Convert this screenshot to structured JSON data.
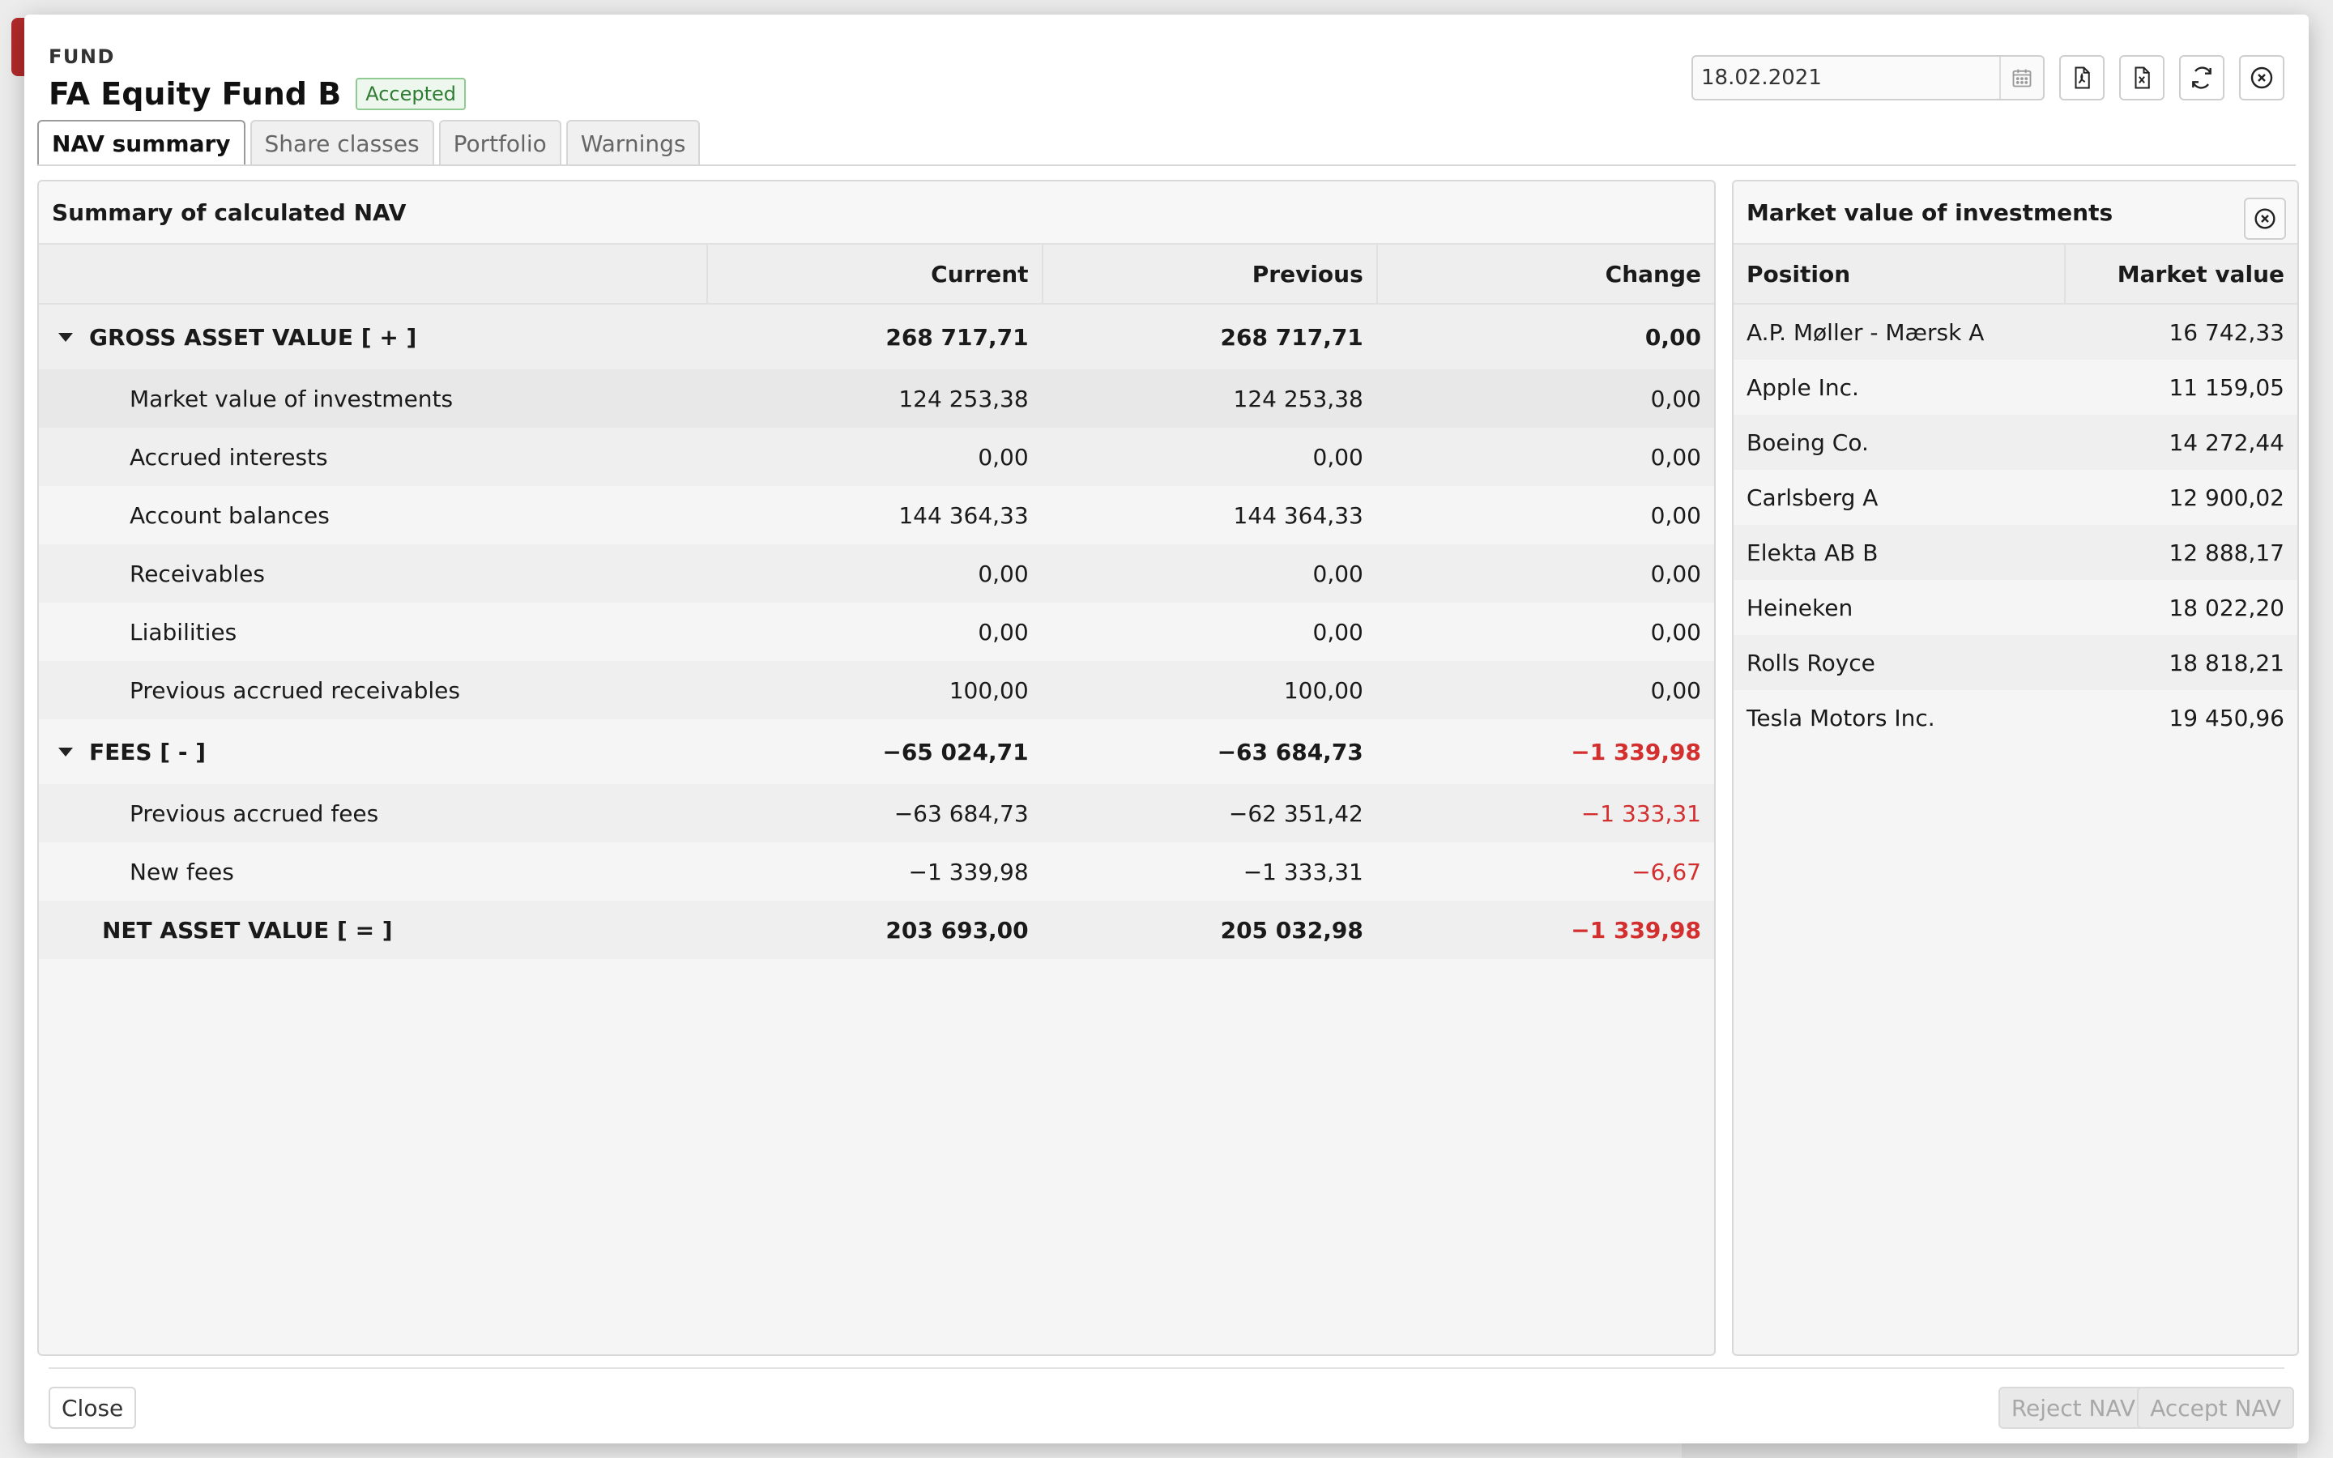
{
  "header": {
    "eyebrow": "FUND",
    "title": "FA Equity Fund B",
    "status": "Accepted",
    "date_value": "18.02.2021"
  },
  "toolbar": {
    "calendar_icon": "calendar-icon",
    "pdf_icon": "file-pdf-icon",
    "excel_icon": "file-excel-icon",
    "refresh_icon": "refresh-icon",
    "close_icon": "close-circle-icon"
  },
  "tabs": [
    {
      "label": "NAV summary",
      "active": true
    },
    {
      "label": "Share classes",
      "active": false
    },
    {
      "label": "Portfolio",
      "active": false
    },
    {
      "label": "Warnings",
      "active": false
    }
  ],
  "nav_summary": {
    "title": "Summary of calculated NAV",
    "columns": [
      "",
      "Current",
      "Previous",
      "Change"
    ],
    "rows": [
      {
        "type": "group",
        "label": "GROSS ASSET VALUE [ + ]",
        "current": "268 717,71",
        "previous": "268 717,71",
        "change": "0,00",
        "neg": false
      },
      {
        "type": "sub",
        "label": "Market value of investments",
        "current": "124 253,38",
        "previous": "124 253,38",
        "change": "0,00",
        "neg": false
      },
      {
        "type": "sub",
        "label": "Accrued interests",
        "current": "0,00",
        "previous": "0,00",
        "change": "0,00",
        "neg": false
      },
      {
        "type": "sub",
        "label": "Account balances",
        "current": "144 364,33",
        "previous": "144 364,33",
        "change": "0,00",
        "neg": false
      },
      {
        "type": "sub",
        "label": "Receivables",
        "current": "0,00",
        "previous": "0,00",
        "change": "0,00",
        "neg": false
      },
      {
        "type": "sub",
        "label": "Liabilities",
        "current": "0,00",
        "previous": "0,00",
        "change": "0,00",
        "neg": false
      },
      {
        "type": "sub",
        "label": "Previous accrued receivables",
        "current": "100,00",
        "previous": "100,00",
        "change": "0,00",
        "neg": false
      },
      {
        "type": "group",
        "label": "FEES [ - ]",
        "current": "−65 024,71",
        "previous": "−63 684,73",
        "change": "−1 339,98",
        "neg": true
      },
      {
        "type": "sub",
        "label": "Previous accrued fees",
        "current": "−63 684,73",
        "previous": "−62 351,42",
        "change": "−1 333,31",
        "neg": true
      },
      {
        "type": "sub",
        "label": "New fees",
        "current": "−1 339,98",
        "previous": "−1 333,31",
        "change": "−6,67",
        "neg": true
      },
      {
        "type": "total",
        "label": "NET ASSET VALUE [ = ]",
        "current": "203 693,00",
        "previous": "205 032,98",
        "change": "−1 339,98",
        "neg": true
      }
    ]
  },
  "market_value": {
    "title": "Market value of investments",
    "col_position": "Position",
    "col_value": "Market value",
    "rows": [
      {
        "position": "A.P. Møller - Mærsk A",
        "value": "16 742,33"
      },
      {
        "position": "Apple Inc.",
        "value": "11 159,05"
      },
      {
        "position": "Boeing Co.",
        "value": "14 272,44"
      },
      {
        "position": "Carlsberg A",
        "value": "12 900,02"
      },
      {
        "position": "Elekta AB B",
        "value": "12 888,17"
      },
      {
        "position": "Heineken",
        "value": "18 022,20"
      },
      {
        "position": "Rolls Royce",
        "value": "18 818,21"
      },
      {
        "position": "Tesla Motors Inc.",
        "value": "19 450,96"
      }
    ]
  },
  "footer": {
    "close_label": "Close",
    "reject_label": "Reject NAV",
    "accept_label": "Accept NAV"
  },
  "colors": {
    "negative": "#d32f2f",
    "accepted": "#2e7d32"
  }
}
